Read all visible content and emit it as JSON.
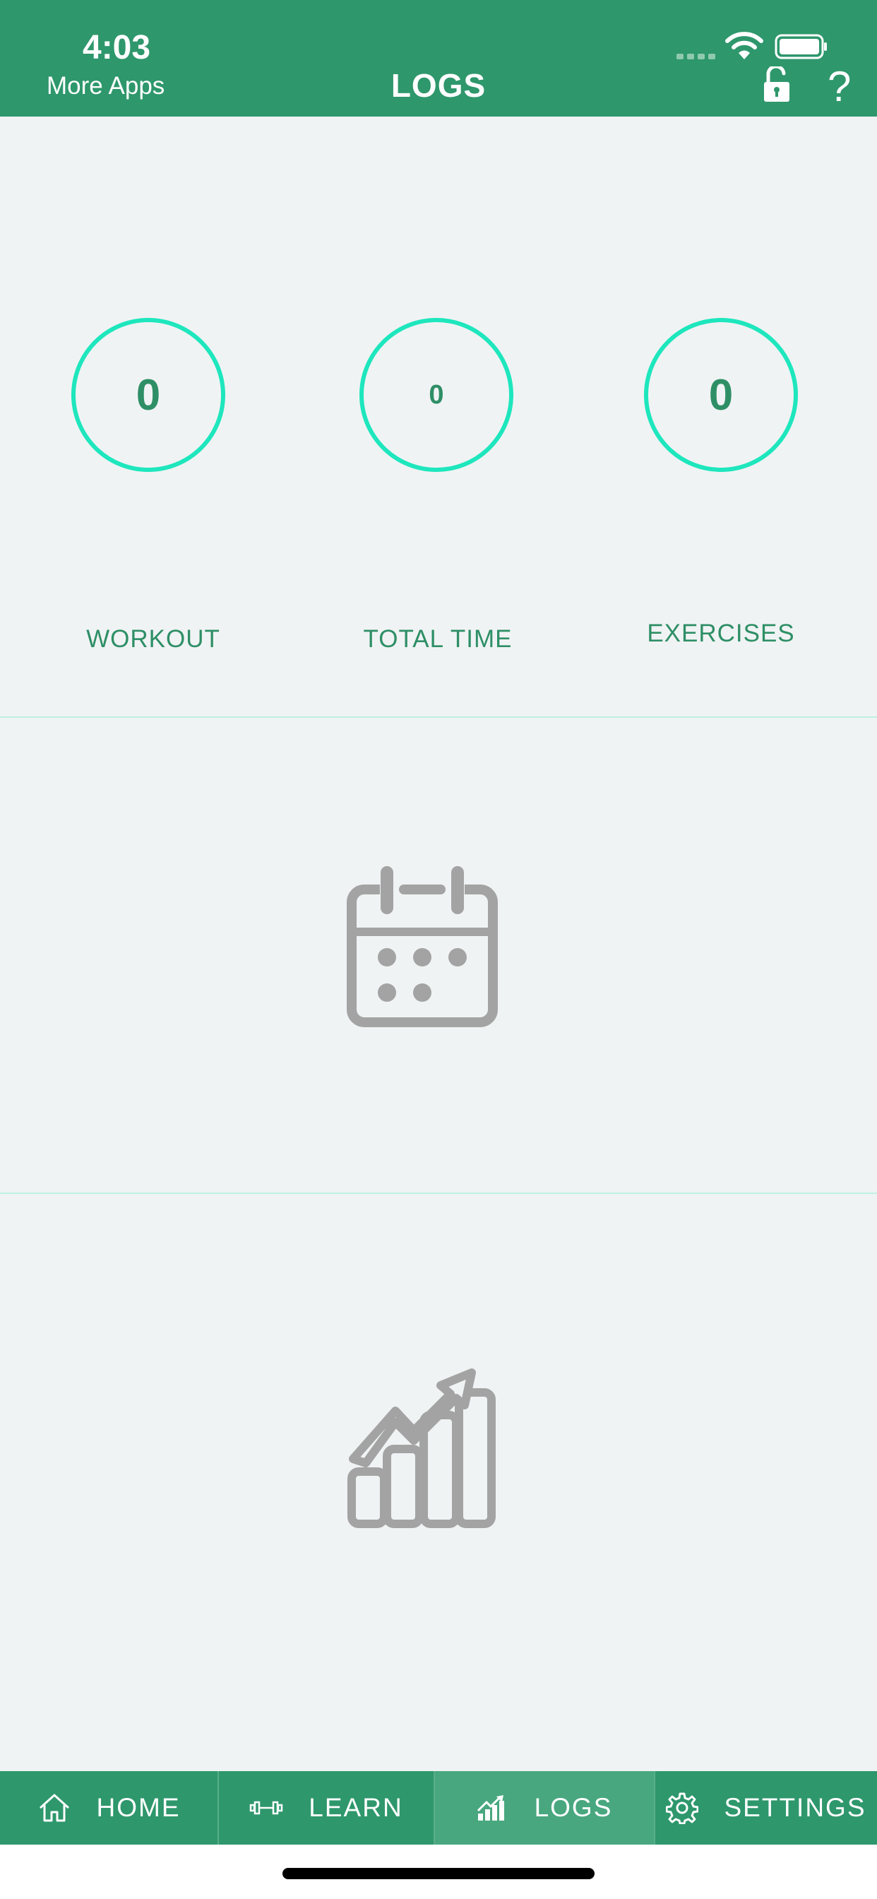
{
  "status_bar": {
    "time": "4:03",
    "back_app": "More Apps"
  },
  "header": {
    "title": "LOGS",
    "help_label": "?"
  },
  "stats": [
    {
      "value": "0",
      "label": "WORKOUT"
    },
    {
      "value": "0",
      "label": "TOTAL TIME"
    },
    {
      "value": "0",
      "label": "EXERCISES"
    }
  ],
  "sections": {
    "calendar_icon": "calendar-icon",
    "chart_icon": "growth-chart-icon"
  },
  "tabs": [
    {
      "label": "HOME",
      "icon": "home-icon"
    },
    {
      "label": "LEARN",
      "icon": "dumbbell-icon"
    },
    {
      "label": "LOGS",
      "icon": "chart-icon",
      "active": true
    },
    {
      "label": "SETTINGS",
      "icon": "gear-icon"
    }
  ],
  "colors": {
    "primary": "#2e976c",
    "accent_ring": "#1ee6bd",
    "stat_text": "#2e8f66",
    "background": "#f0f3f4",
    "icon_gray": "#a3a3a3"
  }
}
